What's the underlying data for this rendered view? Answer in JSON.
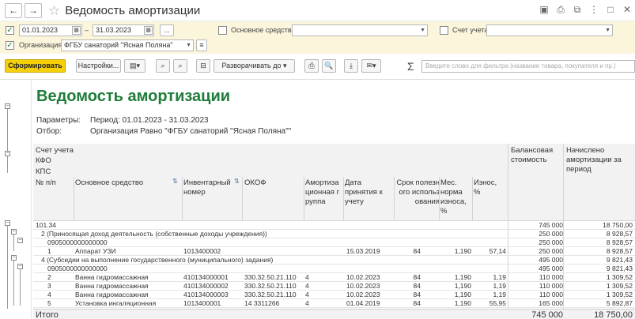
{
  "window": {
    "title": "Ведомость амортизации",
    "back_icon": "←",
    "forward_icon": "→",
    "star_icon": "☆"
  },
  "filters": {
    "period_start": "01.01.2023",
    "period_sep": "–",
    "period_end": "31.03.2023",
    "period_more": "...",
    "asset_label": "Основное средство:",
    "asset_value": "",
    "account_label": "Счет учета:",
    "account_value": "",
    "org_label": "Организация:",
    "org_value": "ФГБУ санаторий \"Ясная Поляна\""
  },
  "toolbar": {
    "generate": "Сформировать",
    "settings": "Настройки...",
    "expand": "Разворачивать до",
    "search_placeholder": "Введите слово для фильтра (название товара, покупателя и пр.)",
    "sigma": "Σ"
  },
  "report": {
    "title": "Ведомость амортизации",
    "params_label": "Параметры:",
    "params_value": "Период: 01.01.2023 - 31.03.2023",
    "filter_label": "Отбор:",
    "filter_value": "Организация Равно \"ФГБУ санаторий \"Ясная Поляна\"\"",
    "columns": {
      "account": "Счет учета",
      "kfo": "КФО",
      "kps": "КПС",
      "num": "№ п/п",
      "asset": "Основное средство",
      "inv": "Инвентарный номер",
      "okof": "ОКОФ",
      "amort_group": "Амортизационная группа",
      "date": "Дата принятия к учету",
      "term": "Срок полезного использования",
      "monthly": "Мес. норма износа, %",
      "wear": "Износ, %",
      "balance": "Балансовая стоимость",
      "accrued": "Начислено амортизации за период"
    },
    "rows": [
      {
        "label": "101.34",
        "balance": "745 000",
        "accrued": "18 750,00"
      },
      {
        "label": "2 (Приносящая доход деятельность (собственные доходы учреждения))",
        "balance": "250 000",
        "accrued": "8 928,57"
      },
      {
        "label": "0905000000000000",
        "balance": "250 000",
        "accrued": "8 928,57"
      },
      {
        "num": "1",
        "asset": "Аппарат УЗИ",
        "inv": "1013400002",
        "okof": "",
        "group": "",
        "date": "15.03.2019",
        "term": "84",
        "monthly": "1,190",
        "wear": "57,14",
        "balance": "250 000",
        "accrued": "8 928,57"
      },
      {
        "label": "4 (Субсидии на выполнение государственного (муниципального) задания)",
        "balance": "495 000",
        "accrued": "9 821,43"
      },
      {
        "label": "0905000000000000",
        "balance": "495 000",
        "accrued": "9 821,43"
      },
      {
        "num": "2",
        "asset": "Ванна гидромассажная",
        "inv": "410134000001",
        "okof": "330.32.50.21.110",
        "group": "4",
        "date": "10.02.2023",
        "term": "84",
        "monthly": "1,190",
        "wear": "1,19",
        "balance": "110 000",
        "accrued": "1 309,52"
      },
      {
        "num": "3",
        "asset": "Ванна гидромассажная",
        "inv": "410134000002",
        "okof": "330.32.50.21.110",
        "group": "4",
        "date": "10.02.2023",
        "term": "84",
        "monthly": "1,190",
        "wear": "1,19",
        "balance": "110 000",
        "accrued": "1 309,52"
      },
      {
        "num": "4",
        "asset": "Ванна гидромассажная",
        "inv": "410134000003",
        "okof": "330.32.50.21.110",
        "group": "4",
        "date": "10.02.2023",
        "term": "84",
        "monthly": "1,190",
        "wear": "1,19",
        "balance": "110 000",
        "accrued": "1 309,52"
      },
      {
        "num": "5",
        "asset": "Установка ингаляционная",
        "inv": "1013400001",
        "okof": "14 3311266",
        "group": "4",
        "date": "01.04.2019",
        "term": "84",
        "monthly": "1,190",
        "wear": "55,95",
        "balance": "165 000",
        "accrued": "5 892,87"
      }
    ],
    "total": {
      "label": "Итого",
      "balance": "745 000",
      "accrued": "18 750,00"
    }
  },
  "colors": {
    "accent": "#f5d10a",
    "title_green": "#1f7c3a",
    "filter_bg": "#fbf5dc"
  }
}
